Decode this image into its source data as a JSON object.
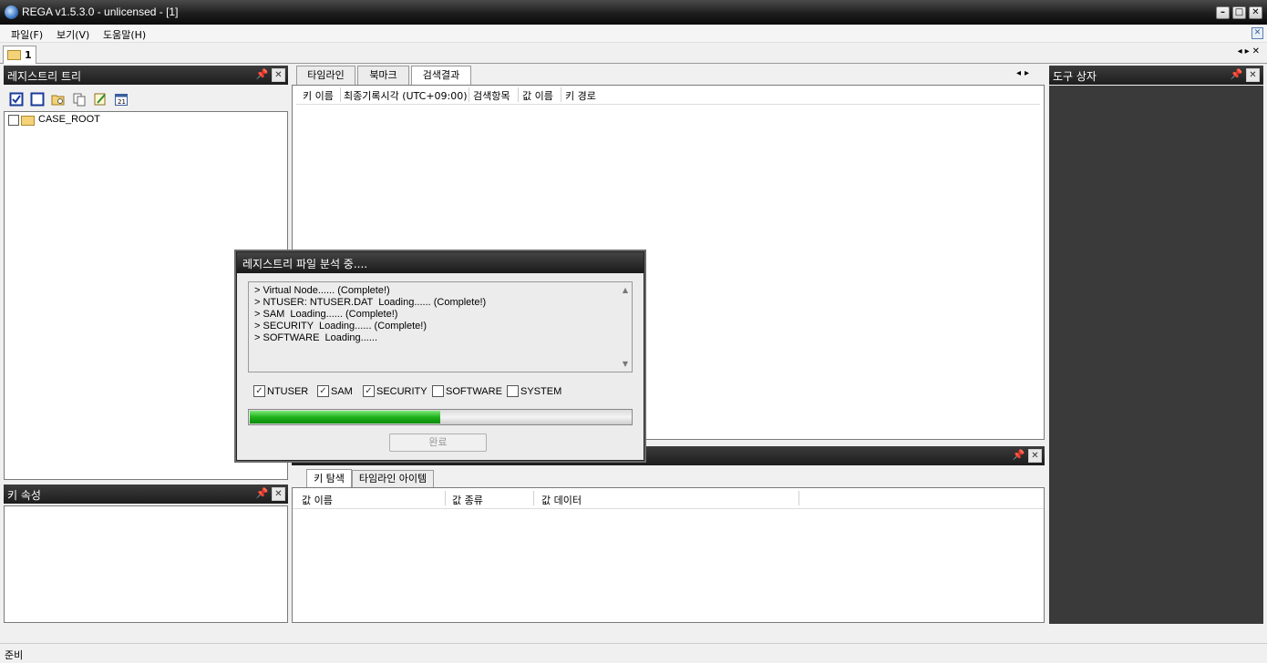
{
  "window": {
    "title": "REGA v1.5.3.0 - unlicensed - [1]"
  },
  "menubar": {
    "items": [
      "파일(F)",
      "보기(V)",
      "도움말(H)"
    ]
  },
  "doc_tab": {
    "label": "1"
  },
  "registry_tree": {
    "title": "레지스트리 트리",
    "root_node": "CASE_ROOT"
  },
  "key_properties": {
    "title": "키 속성"
  },
  "tool_box": {
    "title": "도구 상자"
  },
  "content_tabs": [
    "타임라인",
    "북마크",
    "검색결과"
  ],
  "search_columns": [
    "키 이름",
    "최종기록시각 (UTC+09:00)",
    "검색항목",
    "값 이름",
    "키 경로"
  ],
  "bottom_tabs": [
    "키 탐색",
    "타임라인 아이템"
  ],
  "bottom_columns": [
    "값 이름",
    "값 종류",
    "값 데이터"
  ],
  "dialog": {
    "title": "레지스트리 파일 분석 중....",
    "log_lines": [
      "> Virtual Node...... (Complete!)",
      "> NTUSER: NTUSER.DAT  Loading...... (Complete!)",
      "> SAM  Loading...... (Complete!)",
      "> SECURITY  Loading...... (Complete!)",
      "> SOFTWARE  Loading......"
    ],
    "hives": [
      {
        "label": "NTUSER",
        "checked": true
      },
      {
        "label": "SAM",
        "checked": true
      },
      {
        "label": "SECURITY",
        "checked": true
      },
      {
        "label": "SOFTWARE",
        "checked": false
      },
      {
        "label": "SYSTEM",
        "checked": false
      }
    ],
    "progress_percent": 50,
    "done_button": "완료"
  },
  "statusbar": {
    "text": "준비"
  },
  "colors": {
    "panel_header": "#1d1d1d",
    "toolbox_bg": "#3a3a3a",
    "progress": "#1fb31c"
  }
}
